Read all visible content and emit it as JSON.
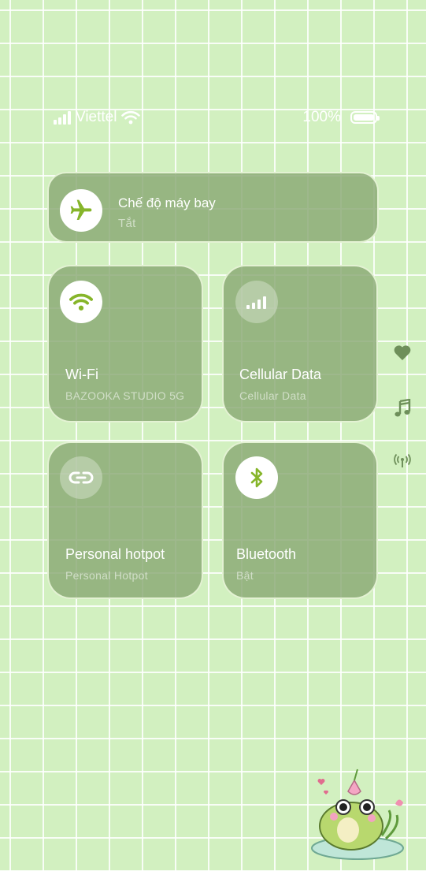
{
  "status_bar": {
    "carrier": "Viettel",
    "battery_percent": "100%",
    "battery_level": 1.0,
    "signal_bars": 4
  },
  "airplane_mode": {
    "label": "Chế độ máy bay",
    "status": "Tắt",
    "icon": "airplane-icon",
    "enabled": false
  },
  "wifi": {
    "label": "Wi-Fi",
    "status": "BAZOOKA STUDIO 5G",
    "icon": "wifi-icon",
    "enabled": true
  },
  "cellular": {
    "label": "Cellular Data",
    "status": "Cellular Data",
    "icon": "cellular-signal-icon",
    "enabled": false
  },
  "hotspot": {
    "label": "Personal hotpot",
    "status": "Personal Hotpot",
    "icon": "link-icon",
    "enabled": false
  },
  "bluetooth": {
    "label": "Bluetooth",
    "status": "Bật",
    "icon": "bluetooth-icon",
    "enabled": true
  },
  "side_icons": [
    "heart-icon",
    "music-note-icon",
    "broadcast-icon"
  ],
  "colors": {
    "background": "#d2f0c0",
    "tile": "#8aa874",
    "accent_green": "#86b52a",
    "grid_line": "#ffffff"
  }
}
